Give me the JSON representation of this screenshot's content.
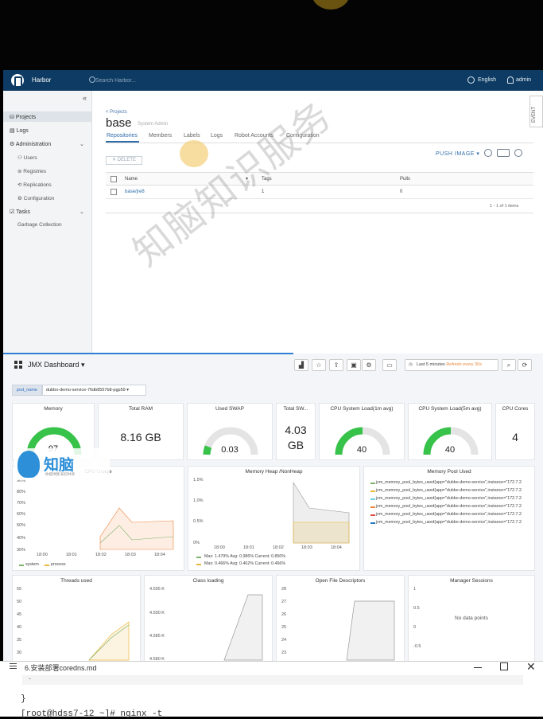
{
  "harbor": {
    "title": "Harbor",
    "search_placeholder": "Search Harbor...",
    "language": "English",
    "user": "admin",
    "collapse_glyph": "«",
    "sidebar": {
      "projects": "Projects",
      "logs": "Logs",
      "administration": "Administration",
      "users": "Users",
      "registries": "Registries",
      "replications": "Replications",
      "configuration": "Configuration",
      "tasks": "Tasks",
      "garbage_collection": "Garbage Collection"
    },
    "breadcrumb": "< Projects",
    "project_name": "base",
    "project_role": "System Admin",
    "tabs": [
      "Repositories",
      "Members",
      "Labels",
      "Logs",
      "Robot Accounts",
      "Configuration"
    ],
    "event_tab": "EVENT",
    "push_image": "PUSH IMAGE",
    "delete_label": "✕  DELETE",
    "table": {
      "headers": [
        "Name",
        "Tags",
        "Pulls"
      ],
      "rows": [
        {
          "name": "base/jre8",
          "tags": "1",
          "pulls": "0"
        }
      ],
      "footer": "1 - 1 of 1 items"
    }
  },
  "grafana": {
    "dashboard_title": "JMX Dashboard ▾",
    "time_range": "Last 5 minutes",
    "refresh": "Refresh every 30s",
    "variable_label": "pod_name",
    "variable_value": "dubbo-demo-service-76db8557b8-pgp59 ▾",
    "panels": {
      "memory": {
        "title": "Memory",
        "value": "97"
      },
      "total_ram": {
        "title": "Total RAM",
        "value": "8.16 GB"
      },
      "used_swap": {
        "title": "Used SWAP",
        "value": "0.03"
      },
      "total_swap": {
        "title": "Total SW...",
        "value": "4.03",
        "unit": "GB"
      },
      "cpu_load_1m": {
        "title": "CPU System Load(1m avg)",
        "value": "40"
      },
      "cpu_load_5m": {
        "title": "CPU System Load(5m avg)",
        "value": "40"
      },
      "cpu_cores": {
        "title": "CPU Cores",
        "value": "4"
      },
      "cpu_usage": {
        "title": "CPU Usage",
        "y_ticks": [
          "90%",
          "80%",
          "70%",
          "60%",
          "50%",
          "40%",
          "30%"
        ],
        "x_ticks": [
          "18:00",
          "18:01",
          "18:02",
          "18:03",
          "18:04"
        ],
        "legend": [
          "system",
          "process"
        ]
      },
      "memory_heap": {
        "title": "Memory Heap /NonHeap",
        "y_ticks": [
          "1.5%",
          "1.0%",
          "0.5%",
          "0%"
        ],
        "x_ticks": [
          "18:00",
          "18:01",
          "18:02",
          "18:03",
          "18:04"
        ],
        "legend": [
          "Max: 1.479%  Avg: 0.986%  Current: 0.850%",
          "Max: 0.466%  Avg: 0.462%  Current: 0.466%"
        ]
      },
      "memory_pool": {
        "title": "Memory Pool Used",
        "legend": [
          "jvm_memory_pool_bytes_used{app=\"dubbo-demo-service\",instance=\"172.7.2",
          "jvm_memory_pool_bytes_used{app=\"dubbo-demo-service\",instance=\"172.7.2",
          "jvm_memory_pool_bytes_used{app=\"dubbo-demo-service\",instance=\"172.7.2",
          "jvm_memory_pool_bytes_used{app=\"dubbo-demo-service\",instance=\"172.7.2",
          "jvm_memory_pool_bytes_used{app=\"dubbo-demo-service\",instance=\"172.7.2",
          "jvm_memory_pool_bytes_used{app=\"dubbo-demo-service\",instance=\"172.7.2"
        ],
        "legend_colors": [
          "#7eb26d",
          "#eab839",
          "#6ed0e0",
          "#ef843c",
          "#e24d42",
          "#1f78c1"
        ]
      },
      "threads": {
        "title": "Threads used",
        "y_ticks": [
          "55",
          "50",
          "45",
          "40",
          "35",
          "30"
        ]
      },
      "class_loading": {
        "title": "Class loading",
        "y_ticks": [
          "4.595 K",
          "4.590 K",
          "4.585 K",
          "4.580 K"
        ]
      },
      "open_files": {
        "title": "Open File Descriptors",
        "y_ticks": [
          "28",
          "27",
          "26",
          "25",
          "24",
          "23"
        ]
      },
      "sessions": {
        "title": "Manager Sessions",
        "y_ticks": [
          "1",
          "0.5",
          "0",
          "-0.5"
        ],
        "no_data": "No data points"
      }
    }
  },
  "editor": {
    "title": "6.安装部署coredns.md",
    "lines": [
      "-",
      "}",
      "[root@hdss7-12 ~]# nginx -t"
    ]
  },
  "watermark": {
    "text": "知脑知识服务",
    "logo_text": "知脑",
    "logo_sub": "你提供我 知识共享"
  },
  "colors": {
    "harbor_header": "#0d3b63",
    "harbor_accent": "#2f6da8",
    "gauge_green": "#37c24a",
    "grafana_accent": "#2d7ed4"
  }
}
